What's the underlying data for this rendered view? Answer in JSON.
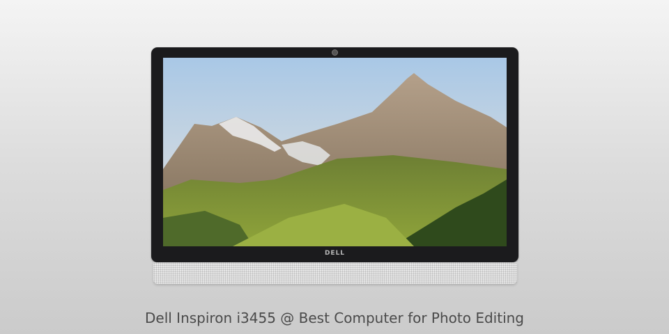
{
  "product": {
    "brand_logo": "DELL"
  },
  "caption": "Dell Inspiron i3455 @ Best Computer for Photo Editing",
  "colors": {
    "bezel": "#1b1b1d",
    "caption": "#4a4a4a",
    "sky": "#b9d3ea"
  }
}
